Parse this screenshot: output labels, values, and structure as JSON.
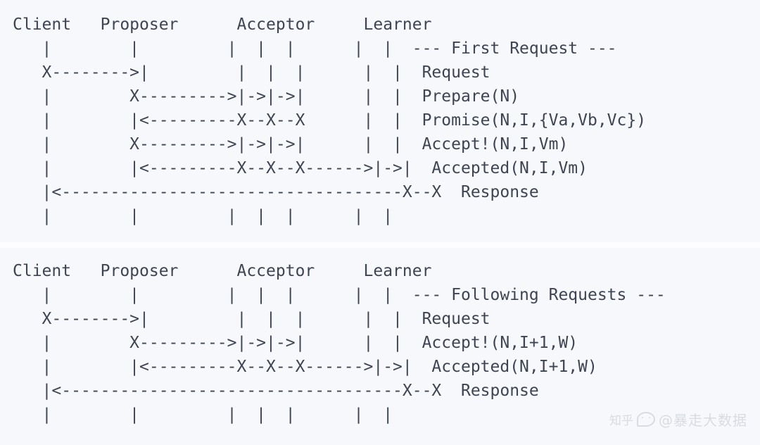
{
  "diagram": {
    "type": "ascii-sequence-diagram",
    "protocol": "Paxos",
    "participants": [
      "Client",
      "Proposer",
      "Acceptor",
      "Learner"
    ],
    "background_color": "#f7f8fb",
    "text_color": "#3e4451",
    "blocks": [
      {
        "id": "first-request",
        "annotation_title": "--- First Request ---",
        "header_line": "Client   Proposer      Acceptor     Learner",
        "message_labels": [
          "--- First Request ---",
          "Request",
          "Prepare(N)",
          "Promise(N,I,{Va,Vb,Vc})",
          "Accept!(N,I,Vm)",
          "Accepted(N,I,Vm)",
          "Response"
        ],
        "ascii": "Client   Proposer      Acceptor     Learner\n   |        |         |  |  |      |  |  --- First Request ---\n   X-------->|         |  |  |      |  |  Request\n   |        X--------->|->|->|      |  |  Prepare(N)\n   |        |<---------X--X--X      |  |  Promise(N,I,{Va,Vb,Vc})\n   |        X--------->|->|->|      |  |  Accept!(N,I,Vm)\n   |        |<---------X--X--X------>|->|  Accepted(N,I,Vm)\n   |<-----------------------------------X--X  Response\n   |        |         |  |  |      |  |"
      },
      {
        "id": "following-requests",
        "annotation_title": "--- Following Requests ---",
        "header_line": "Client   Proposer      Acceptor     Learner",
        "message_labels": [
          "--- Following Requests ---",
          "Request",
          "Accept!(N,I+1,W)",
          "Accepted(N,I+1,W)",
          "Response"
        ],
        "ascii": "Client   Proposer      Acceptor     Learner\n   |        |         |  |  |      |  |  --- Following Requests ---\n   X-------->|         |  |  |      |  |  Request\n   |        X--------->|->|->|      |  |  Accept!(N,I+1,W)\n   |        |<---------X--X--X------>|->|  Accepted(N,I+1,W)\n   |<-----------------------------------X--X  Response\n   |        |         |  |  |      |  |"
      }
    ]
  },
  "watermark": {
    "platform_label": "知乎",
    "author_label": "@暴走大数据"
  }
}
